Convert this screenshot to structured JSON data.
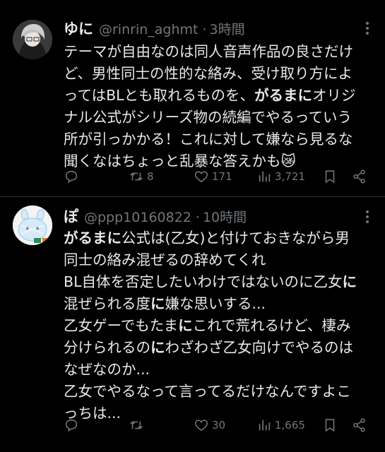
{
  "tweets": [
    {
      "name": "ゆに",
      "handle": "@rinrin_aghmt",
      "separator": "·",
      "time": "3時間",
      "lines": [
        [
          {
            "t": "テーマが自由なのは同人音声作品の良さだけ"
          }
        ],
        [
          {
            "t": "ど、男性同士の性的な絡み、受け取り方によ"
          }
        ],
        [
          {
            "t": "ってはBLとも取れるものを、"
          },
          {
            "t": "がるまに",
            "b": true
          },
          {
            "t": "オリジ"
          }
        ],
        [
          {
            "t": "ナル公式がシリーズ物の続編でやるっていう"
          }
        ],
        [
          {
            "t": "所が引っかかる！これに対して嫌なら見るな"
          }
        ],
        [
          {
            "t": "聞くなはちょっと乱暴な答えかも😿"
          }
        ]
      ],
      "actions": {
        "reply": "",
        "retweet": "8",
        "like": "171",
        "views": "3,721"
      }
    },
    {
      "name": "ぽ",
      "handle": "@ppp10160822",
      "separator": "·",
      "time": "10時間",
      "lines": [
        [
          {
            "t": "がるまに",
            "b": true
          },
          {
            "t": "公式は(乙女)と付けておきながら男"
          }
        ],
        [
          {
            "t": "同士の絡み混ぜるの辞めてくれ"
          }
        ],
        [
          {
            "t": "BL自体を否定したいわけではないのに乙女"
          },
          {
            "t": "に",
            "b": true
          }
        ],
        [
          {
            "t": "混ぜられる度"
          },
          {
            "t": "に",
            "b": true
          },
          {
            "t": "嫌な思いする..."
          }
        ],
        [
          {
            "t": "乙女ゲーでもたま"
          },
          {
            "t": "に",
            "b": true
          },
          {
            "t": "これで荒れるけど、棲み"
          }
        ],
        [
          {
            "t": "分けられるの"
          },
          {
            "t": "に",
            "b": true
          },
          {
            "t": "わざわざ乙女向けでやるのは"
          }
        ],
        [
          {
            "t": "なぜなのか..."
          }
        ],
        [
          {
            "t": "乙女でやるなって言ってるだけなんですよこ"
          }
        ],
        [
          {
            "t": "っちは..."
          }
        ]
      ],
      "actions": {
        "reply": "",
        "retweet": "",
        "like": "30",
        "views": "1,665"
      }
    }
  ],
  "icons": [
    "reply-icon",
    "retweet-icon",
    "like-icon",
    "views-icon",
    "bookmark-icon",
    "share-icon",
    "more-icon"
  ]
}
